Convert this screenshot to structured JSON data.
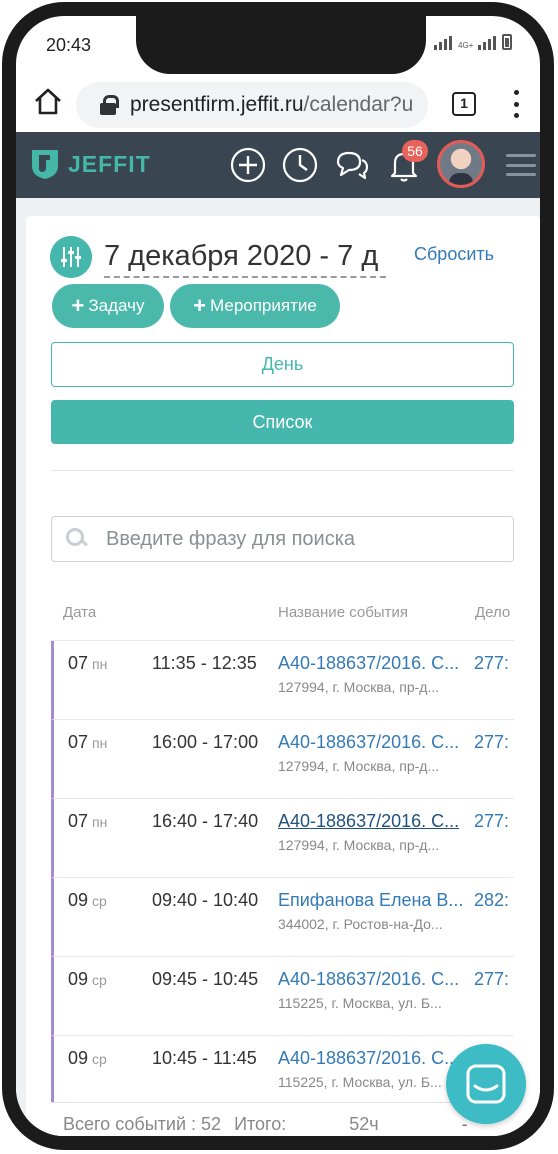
{
  "status_bar": {
    "time": "20:43",
    "network": "4G+"
  },
  "browser": {
    "url_host": "presentfirm.jeffit.ru",
    "url_path": "/calendar?u",
    "tab_count": "1"
  },
  "header": {
    "logo_text": "JEFFIT",
    "notification_count": "56",
    "colors": {
      "bar": "#394551",
      "accent": "#45b7ad",
      "badge": "#e8635c"
    }
  },
  "toolbar": {
    "date_range": "7 декабря 2020 - 7 д",
    "reset_label": "Сбросить",
    "task_label": "Задачу",
    "event_label": "Мероприятие",
    "day_label": "День",
    "list_label": "Список"
  },
  "search": {
    "placeholder": "Введите фразу для поиска"
  },
  "table": {
    "columns": [
      "Дата",
      "Название события",
      "Дело"
    ],
    "rows": [
      {
        "day": "07",
        "weekday": "пн",
        "time": "11:35 - 12:35",
        "title": "А40-188637/2016. С...",
        "address": "127994, г. Москва, пр-д...",
        "case": "277:"
      },
      {
        "day": "07",
        "weekday": "пн",
        "time": "16:00 - 17:00",
        "title": "А40-188637/2016. С...",
        "address": "127994, г. Москва, пр-д...",
        "case": "277:"
      },
      {
        "day": "07",
        "weekday": "пн",
        "time": "16:40 - 17:40",
        "title": "А40-188637/2016. С...",
        "address": "127994, г. Москва, пр-д...",
        "case": "277:"
      },
      {
        "day": "09",
        "weekday": "ср",
        "time": "09:40 - 10:40",
        "title": "Епифанова Елена В...",
        "address": "344002, г. Ростов-на-До...",
        "case": "282:"
      },
      {
        "day": "09",
        "weekday": "ср",
        "time": "09:45 - 10:45",
        "title": "А40-188637/2016. С...",
        "address": "115225, г. Москва, ул. Б...",
        "case": "277:"
      },
      {
        "day": "09",
        "weekday": "ср",
        "time": "10:45 - 11:45",
        "title": "А40-188637/2016. С...",
        "address": "115225, г. Москва, ул. Б...",
        "case": ""
      }
    ]
  },
  "footer": {
    "total_events": "Всего событий : 52",
    "total_label": "Итого:",
    "total_hours": "52ч",
    "dash": "-"
  }
}
